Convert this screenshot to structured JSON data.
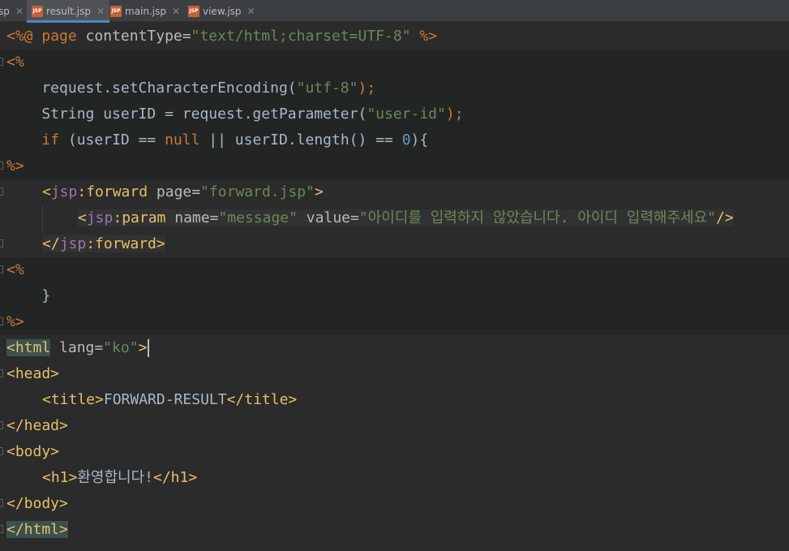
{
  "tabs": [
    {
      "label": "sp",
      "icon": "jsp-file-icon",
      "active": false
    },
    {
      "label": "result.jsp",
      "icon": "jsp-file-icon",
      "active": true
    },
    {
      "label": "main.jsp",
      "icon": "jsp-file-icon",
      "active": false
    },
    {
      "label": "view.jsp",
      "icon": "jsp-file-icon",
      "active": false
    }
  ],
  "file_icon_text": "JSP",
  "close_glyph": "✕",
  "code": {
    "l1": {
      "a": "<%@ ",
      "b": "page",
      "c": " contentType=",
      "d": "\"text/html;charset=UTF-8\"",
      "e": " %>"
    },
    "l2": {
      "a": "<%"
    },
    "l3": {
      "a": "    request.setCharacterEncoding(",
      "b": "\"utf-8\"",
      "c": ");"
    },
    "l4": {
      "a": "    String userID = request.getParameter(",
      "b": "\"user-id\"",
      "c": ");"
    },
    "l5": {
      "a": "    ",
      "b": "if",
      "c": " (userID == ",
      "d": "null",
      "e": " || userID.length() == ",
      "f": "0",
      "g": "){"
    },
    "l6": {
      "a": "%>"
    },
    "l7": {
      "a": "<",
      "b": "jsp",
      "c": ":forward",
      "d": " page=",
      "e": "\"forward.jsp\"",
      "f": ">"
    },
    "l8": {
      "a": "<",
      "b": "jsp",
      "c": ":param",
      "d": " name=",
      "e": "\"message\"",
      "f": " value=",
      "g": "\"아이디를 입력하지 않았습니다. 아이디 입력해주세요\"",
      "h": "/>"
    },
    "l9": {
      "a": "</",
      "b": "jsp",
      "c": ":forward",
      "d": ">"
    },
    "l10": {
      "a": "<%"
    },
    "l11": {
      "a": "    }"
    },
    "l12": {
      "a": "%>"
    },
    "l13": {
      "a": "<html",
      "b": " lang=",
      "c": "\"ko\"",
      "d": ">"
    },
    "l14": {
      "a": "<head>"
    },
    "l15": {
      "a": "<title>",
      "b": "FORWARD-RESULT",
      "c": "</title>"
    },
    "l16": {
      "a": "</head>"
    },
    "l17": {
      "a": "<body>"
    },
    "l18": {
      "a": "<h1>",
      "b": "환영합니다!",
      "c": "</h1>"
    },
    "l19": {
      "a": "</body>"
    },
    "l20": {
      "a": "</html>"
    }
  }
}
